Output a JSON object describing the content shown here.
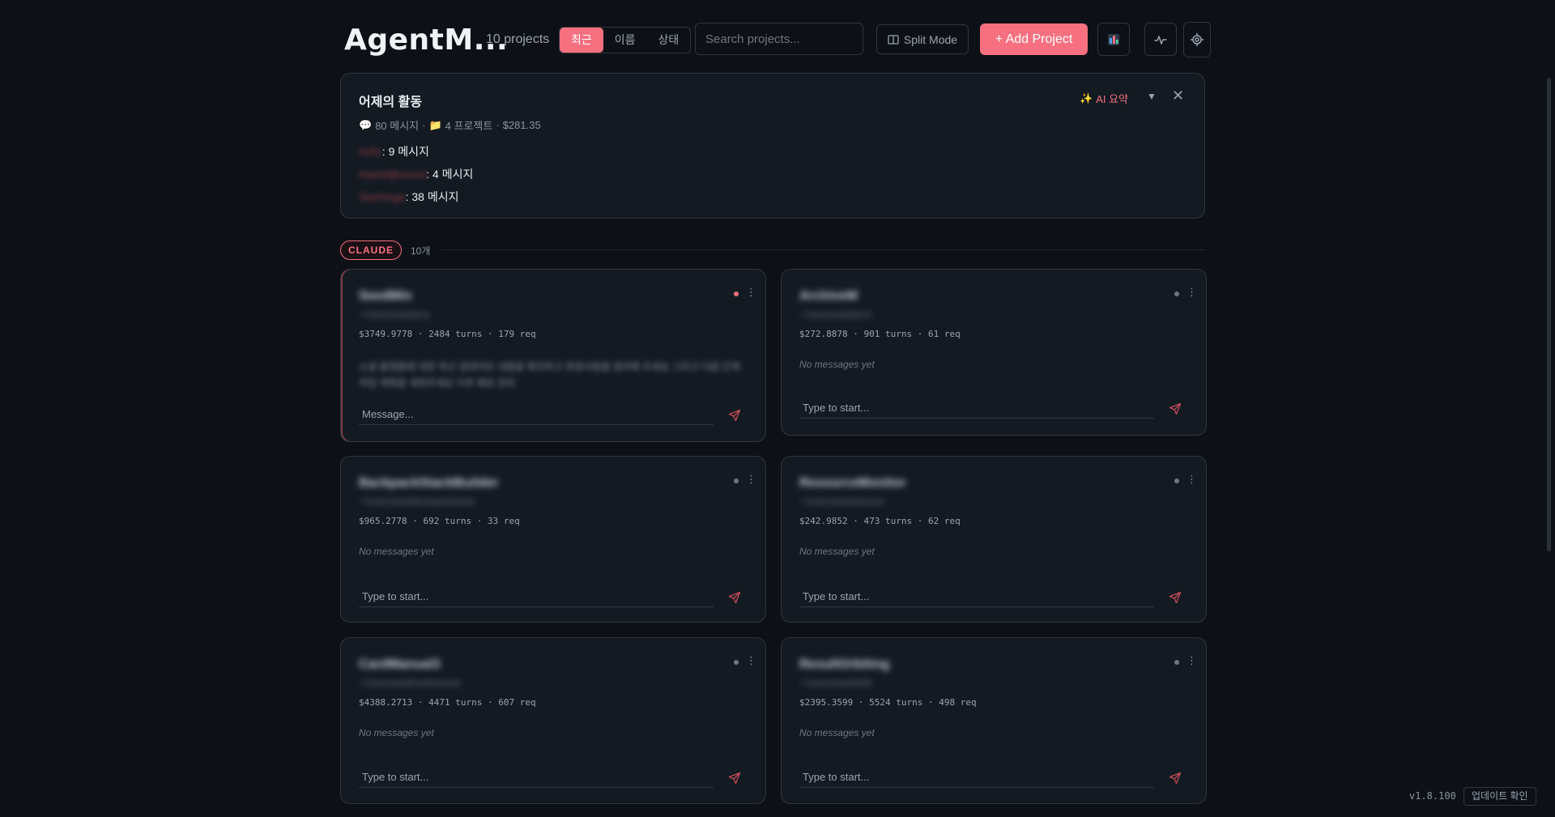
{
  "header": {
    "title": "AgentM...",
    "project_count": "10 projects",
    "sort_tabs": [
      "최근",
      "이름",
      "상태"
    ],
    "search_placeholder": "Search projects...",
    "split_mode": "Split Mode",
    "add_project": "+ Add Project"
  },
  "activity": {
    "title": "어제의 활동",
    "messages": "80 메시지",
    "projects": "4 프로젝트",
    "cost": "$281.35",
    "ai_summary": "AI 요약",
    "lines": [
      {
        "name": "ncfic",
        "count": ": 9 메시지"
      },
      {
        "name": "Hartelijkscool",
        "count": ": 4 메시지"
      },
      {
        "name": "Starforge",
        "count": ": 38 메시지"
      }
    ]
  },
  "section": {
    "badge": "CLAUDE",
    "count": "10개"
  },
  "cards": [
    {
      "name": "SeedMin",
      "sub": "~/Users/seed/proj",
      "cost": "$3749.9778",
      "turns": "2484 turns",
      "req": "179 req",
      "message": "소셜 플랫폼에 대한 최신 업데이트 내용을 확인하고 변경사항을 정리해 주세요 그리고 다음 단계 작업 계획을 세워주세요 이후 배포 준비",
      "placeholder": "Message...",
      "status": "live"
    },
    {
      "name": "ArchiveM",
      "sub": "~/Users/seed/arch",
      "cost": "$272.8878",
      "turns": "901 turns",
      "req": "61 req",
      "message": "No messages yet",
      "placeholder": "Type to start...",
      "status": "idle"
    },
    {
      "name": "BackpackStackBuilder",
      "sub": "~/Users/seed/backpack/stack",
      "cost": "$965.2778",
      "turns": "692 turns",
      "req": "33 req",
      "message": "No messages yet",
      "placeholder": "Type to start...",
      "status": "idle"
    },
    {
      "name": "ResourceMonitor",
      "sub": "~/Users/seed/resmon",
      "cost": "$242.9852",
      "turns": "473 turns",
      "req": "62 req",
      "message": "No messages yet",
      "placeholder": "Type to start...",
      "status": "idle"
    },
    {
      "name": "CardManual3",
      "sub": "~/Users/seed/cardmanual",
      "cost": "$4388.2713",
      "turns": "4471 turns",
      "req": "607 req",
      "message": "No messages yet",
      "placeholder": "Type to start...",
      "status": "idle"
    },
    {
      "name": "ResultOrbiting",
      "sub": "~/Users/seed/orbit",
      "cost": "$2395.3599",
      "turns": "5524 turns",
      "req": "498 req",
      "message": "No messages yet",
      "placeholder": "Type to start...",
      "status": "idle"
    }
  ],
  "footer": {
    "version": "v1.8.100",
    "update": "업데이트 확인"
  },
  "colors": {
    "accent": "#f7707f",
    "background": "#0d1117",
    "card": "#141a22",
    "border": "#30363d"
  }
}
